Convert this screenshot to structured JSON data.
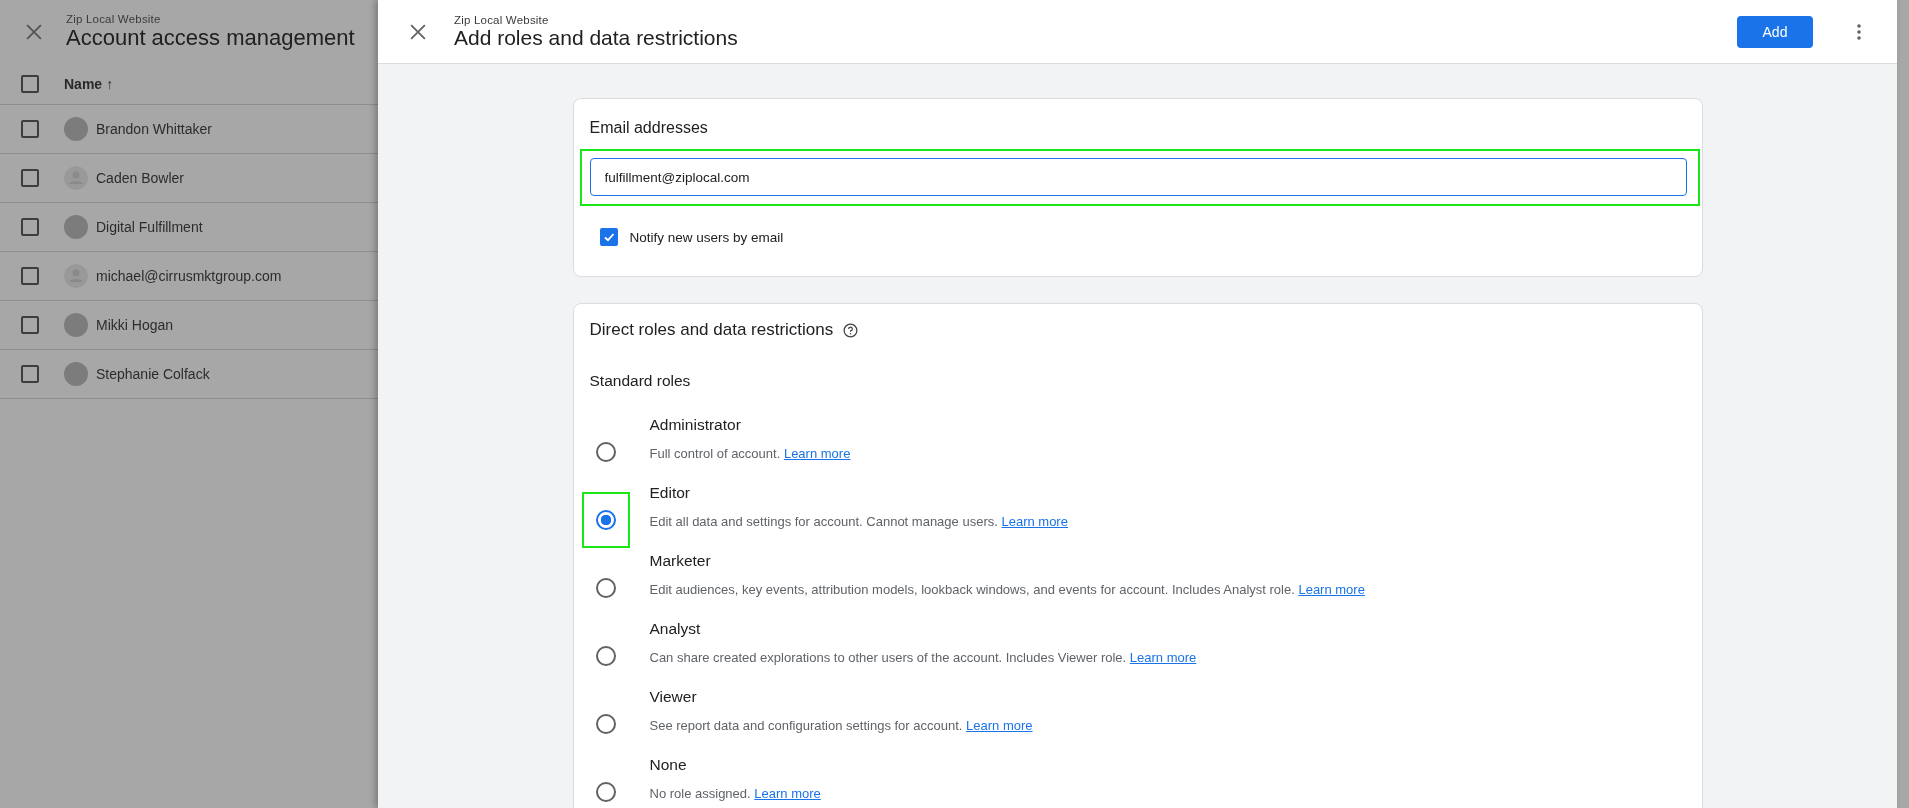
{
  "background_panel": {
    "subtitle": "Zip Local Website",
    "title": "Account access management",
    "table": {
      "select_all_checked": false,
      "column_name": "Name",
      "sort_arrow": "↑",
      "rows": [
        {
          "name": "Brandon Whittaker",
          "checked": false,
          "kind": "photo"
        },
        {
          "name": "Caden Bowler",
          "checked": false,
          "kind": "generic"
        },
        {
          "name": "Digital Fulfillment",
          "checked": false,
          "kind": "photo"
        },
        {
          "name": "michael@cirrusmktgroup.com",
          "checked": false,
          "kind": "generic"
        },
        {
          "name": "Mikki Hogan",
          "checked": false,
          "kind": "photo"
        },
        {
          "name": "Stephanie Colfack",
          "checked": false,
          "kind": "photo"
        }
      ]
    }
  },
  "drawer": {
    "subtitle": "Zip Local Website",
    "title": "Add roles and data restrictions",
    "primary_button": "Add",
    "email_card": {
      "label": "Email addresses",
      "value": "fulfillment@ziplocal.com",
      "highlighted": true,
      "notify": {
        "label": "Notify new users by email",
        "checked": true
      }
    },
    "roles_card": {
      "title": "Direct roles and data restrictions",
      "section": "Standard roles",
      "roles": [
        {
          "name": "Administrator",
          "description": "Full control of account.",
          "link": "Learn more",
          "selected": false,
          "highlighted": false
        },
        {
          "name": "Editor",
          "description": "Edit all data and settings for account. Cannot manage users.",
          "link": "Learn more",
          "selected": true,
          "highlighted": true
        },
        {
          "name": "Marketer",
          "description": "Edit audiences, key events, attribution models, lookback windows, and events for account. Includes Analyst role.",
          "link": "Learn more",
          "selected": false,
          "highlighted": false
        },
        {
          "name": "Analyst",
          "description": "Can share created explorations to other users of the account. Includes Viewer role.",
          "link": "Learn more",
          "selected": false,
          "highlighted": false
        },
        {
          "name": "Viewer",
          "description": "See report data and configuration settings for account.",
          "link": "Learn more",
          "selected": false,
          "highlighted": false
        },
        {
          "name": "None",
          "description": "No role assigned.",
          "link": "Learn more",
          "selected": false,
          "highlighted": false
        }
      ]
    }
  }
}
